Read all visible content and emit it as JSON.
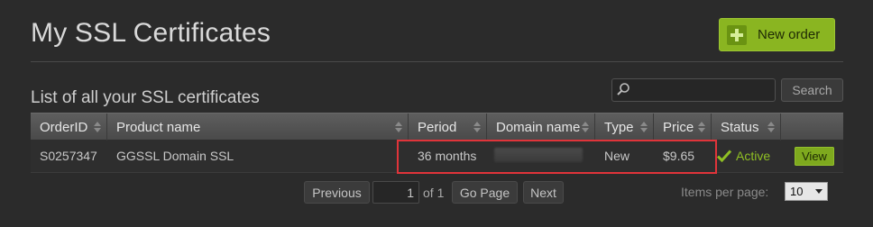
{
  "header": {
    "title": "My SSL Certificates",
    "new_order_label": "New order"
  },
  "list": {
    "subtitle": "List of all your SSL certificates",
    "search_placeholder": "",
    "search_button": "Search"
  },
  "table": {
    "columns": [
      "OrderID",
      "Product name",
      "Period",
      "Domain name",
      "Type",
      "Price",
      "Status",
      ""
    ],
    "rows": [
      {
        "order_id": "S0257347",
        "product": "GGSSL Domain SSL",
        "period": "36 months",
        "domain": "",
        "type": "New",
        "price": "$9.65",
        "status": "Active",
        "action": "View"
      }
    ]
  },
  "pagination": {
    "previous": "Previous",
    "page_value": "1",
    "of_text": "of 1",
    "go_page": "Go Page",
    "next": "Next",
    "items_per_page_label": "Items per page:",
    "items_per_page_value": "10"
  },
  "colors": {
    "accent_green": "#8ab521",
    "highlight_red": "#e0343a",
    "background": "#2b2b2b"
  },
  "icons": [
    "plus-icon",
    "search-icon",
    "sort-icon",
    "check-icon",
    "caret-down-icon"
  ]
}
